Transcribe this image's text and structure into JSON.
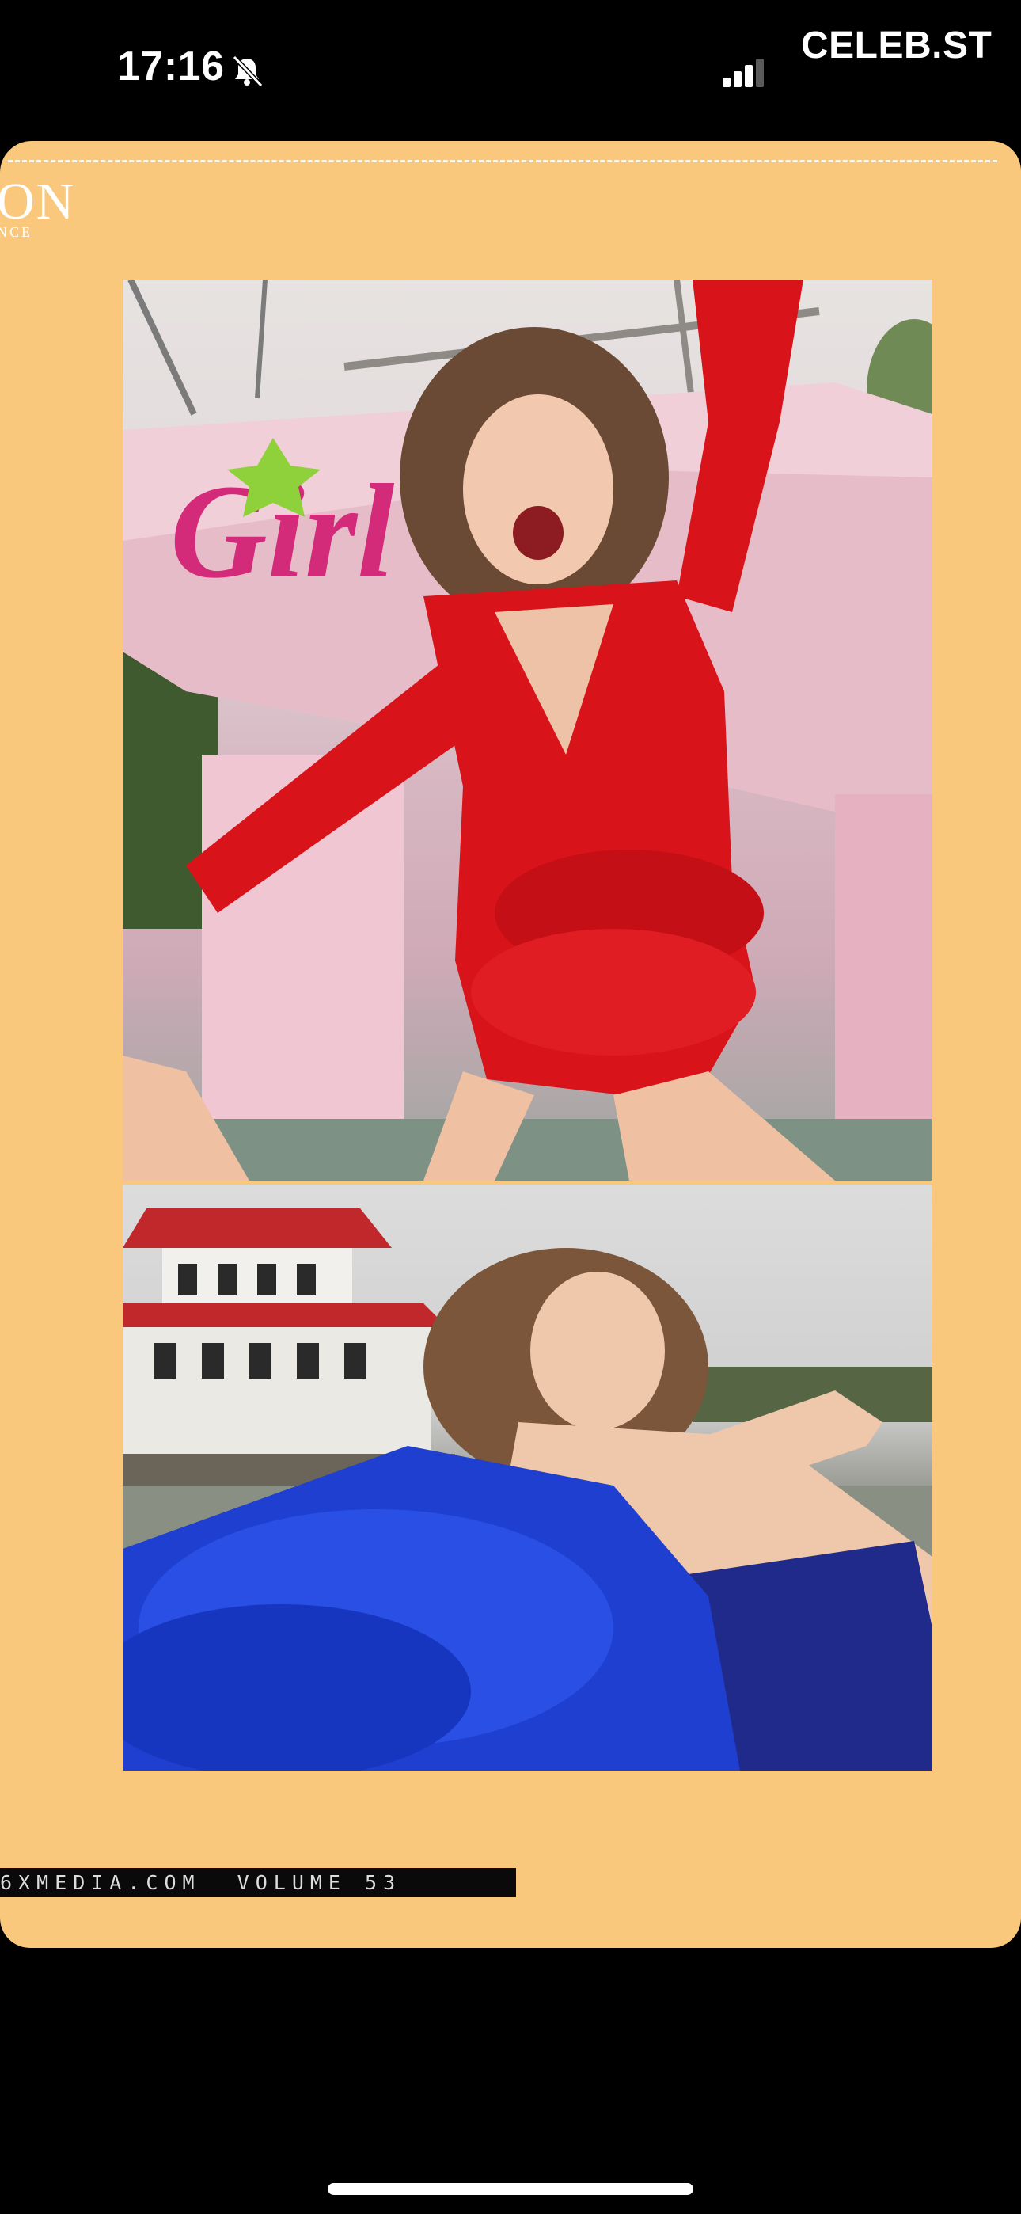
{
  "status_bar": {
    "time": "17:16",
    "silent_icon": "bell-slash-icon",
    "signal_icon": "cellular-signal-icon",
    "watermark": "CELEB.ST"
  },
  "story": {
    "background_color": "#f9c87c",
    "masthead_big": "ON",
    "masthead_small": "NCE",
    "photos": [
      {
        "name": "photo-red-dress",
        "boat_lettering": "Girl"
      },
      {
        "name": "photo-blue-dress"
      }
    ],
    "footer_text": "6XMEDIA.COM  VOLUME 53"
  },
  "colors": {
    "accent_red": "#d8141a",
    "accent_blue": "#1e3fd0"
  }
}
